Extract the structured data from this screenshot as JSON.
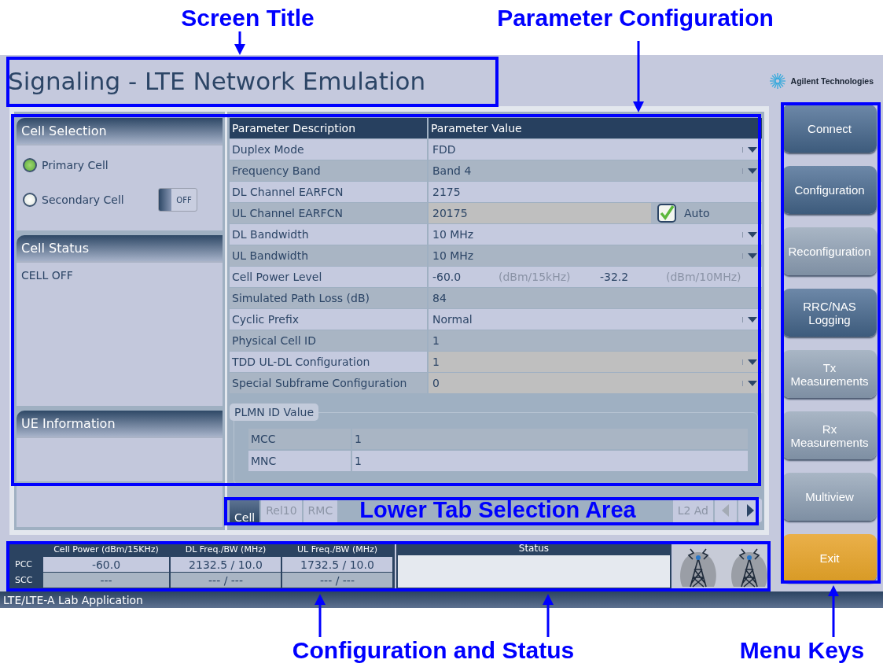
{
  "annotations": [
    {
      "label": "Screen Title"
    },
    {
      "label": "Parameter Configuration"
    },
    {
      "label": "Lower Tab Selection Area"
    },
    {
      "label": "Configuration and Status"
    },
    {
      "label": "Menu Keys"
    }
  ],
  "window": {
    "title": "Signaling - LTE Network Emulation",
    "logo_text": "Agilent Technologies"
  },
  "cell_selection": {
    "title": "Cell Selection",
    "options": [
      {
        "label": "Primary Cell",
        "selected": true
      },
      {
        "label": "Secondary Cell",
        "selected": false
      }
    ],
    "toggle": {
      "label": "OFF",
      "on": false
    }
  },
  "cell_status": {
    "title": "Cell Status",
    "text": "CELL OFF"
  },
  "ue_information": {
    "title": "UE Information"
  },
  "parameters": {
    "columns": [
      "Parameter Description",
      "Parameter Value"
    ],
    "rows": [
      {
        "name": "Duplex Mode",
        "kind": "dropdown",
        "value": "FDD",
        "disabled": false
      },
      {
        "name": "Frequency Band",
        "kind": "dropdown",
        "value": "Band 4",
        "disabled": false
      },
      {
        "name": "DL Channel EARFCN",
        "kind": "text",
        "value": "2175",
        "disabled": false
      },
      {
        "name": "UL Channel EARFCN",
        "kind": "auto",
        "value": "20175",
        "disabled": true,
        "checkbox": {
          "label": "Auto",
          "checked": true
        }
      },
      {
        "name": "DL Bandwidth",
        "kind": "dropdown",
        "value": "10 MHz",
        "disabled": false
      },
      {
        "name": "UL Bandwidth",
        "kind": "dropdown",
        "value": "10 MHz",
        "disabled": false
      },
      {
        "name": "Cell Power Level",
        "kind": "power",
        "fields": [
          {
            "value": "-60.0",
            "unit": "(dBm/15kHz)"
          },
          {
            "value": "-32.2",
            "unit": "(dBm/10MHz)"
          }
        ]
      },
      {
        "name": "Simulated Path Loss (dB)",
        "kind": "text",
        "value": "84",
        "disabled": false
      },
      {
        "name": "Cyclic Prefix",
        "kind": "dropdown",
        "value": "Normal",
        "disabled": false
      },
      {
        "name": "Physical Cell ID",
        "kind": "text",
        "value": "1",
        "disabled": false
      },
      {
        "name": "TDD UL-DL Configuration",
        "kind": "dropdown",
        "value": "1",
        "disabled": true
      },
      {
        "name": "Special Subframe Configuration",
        "kind": "dropdown",
        "value": "0",
        "disabled": true
      }
    ]
  },
  "plmn": {
    "title": "PLMN ID Value",
    "rows": [
      {
        "name": "MCC",
        "value": "1"
      },
      {
        "name": "MNC",
        "value": "1"
      }
    ]
  },
  "lower_tabs": [
    {
      "label": "Cell",
      "selected": true
    },
    {
      "label": "Rel10",
      "selected": false
    },
    {
      "label": "RMC",
      "selected": false
    },
    {
      "label": "L2 Ad",
      "selected": false
    }
  ],
  "tab_scroll": {
    "left_disabled": true,
    "right_disabled": false
  },
  "status_table": {
    "columns": [
      "Cell Power (dBm/15KHz)",
      "DL Freq./BW (MHz)",
      "UL Freq./BW (MHz)"
    ],
    "rows": [
      {
        "label": "PCC",
        "cells": [
          "-60.0",
          "2132.5 / 10.0",
          "1732.5 / 10.0"
        ]
      },
      {
        "label": "SCC",
        "cells": [
          "---",
          "--- / ---",
          "--- / ---"
        ]
      }
    ]
  },
  "status": {
    "title": "Status"
  },
  "menu_keys": [
    {
      "lines": [
        "Connect"
      ],
      "kind": "normal",
      "disabled": false
    },
    {
      "lines": [
        "Configuration"
      ],
      "kind": "normal",
      "disabled": false
    },
    {
      "lines": [
        "Reconfiguration"
      ],
      "kind": "normal",
      "disabled": true
    },
    {
      "lines": [
        "RRC/NAS",
        "Logging"
      ],
      "kind": "normal",
      "disabled": false
    },
    {
      "lines": [
        "Tx",
        "Measurements"
      ],
      "kind": "normal",
      "disabled": true
    },
    {
      "lines": [
        "Rx",
        "Measurements"
      ],
      "kind": "normal",
      "disabled": true
    },
    {
      "lines": [
        "Multiview"
      ],
      "kind": "normal",
      "disabled": true
    },
    {
      "lines": [
        "Exit"
      ],
      "kind": "exit",
      "disabled": false
    }
  ],
  "app_bar": {
    "text": "LTE/LTE-A Lab Application"
  }
}
